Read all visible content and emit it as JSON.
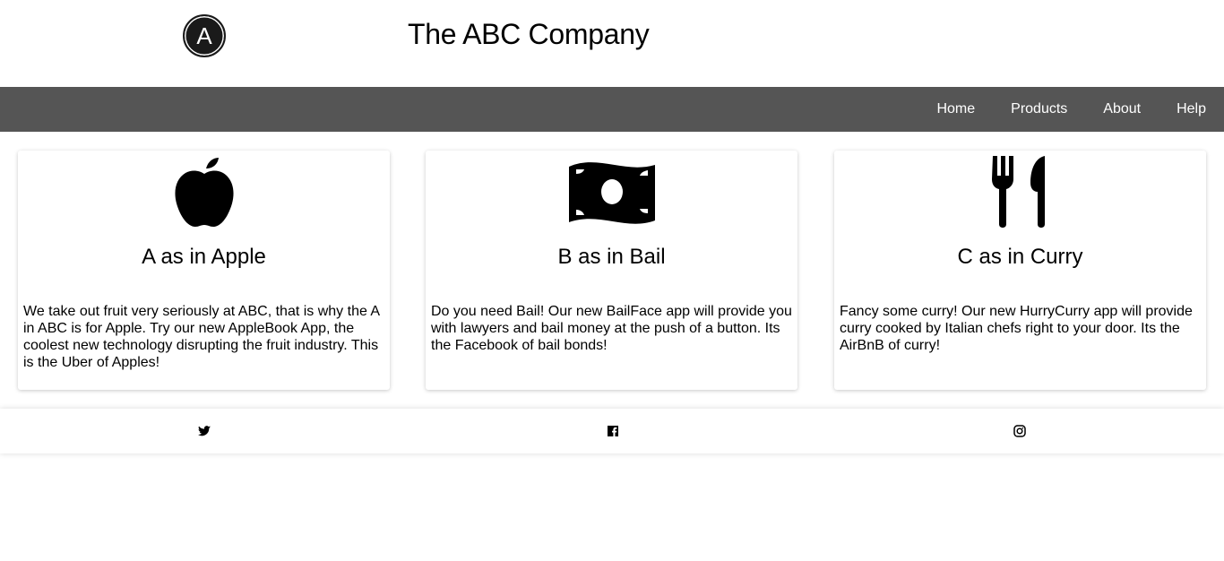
{
  "header": {
    "logo_letter": "A",
    "title": "The ABC Company"
  },
  "nav": {
    "items": [
      "Home",
      "Products",
      "About",
      "Help"
    ]
  },
  "cards": [
    {
      "icon": "apple-icon",
      "title": "A as in Apple",
      "text": "We take out fruit very seriously at ABC, that is why the A in ABC is for Apple. Try our new AppleBook App, the coolest new technology disrupting the fruit industry. This is the Uber of Apples!"
    },
    {
      "icon": "money-bill-icon",
      "title": "B as in Bail",
      "text": "Do you need Bail! Our new BailFace app will provide you with lawyers and bail money at the push of a button. Its the Facebook of bail bonds!"
    },
    {
      "icon": "utensils-icon",
      "title": "C as in Curry",
      "text": "Fancy some curry! Our new HurryCurry app will provide curry cooked by Italian chefs right to your door. Its the AirBnB of curry!"
    }
  ],
  "footer": {
    "icons": [
      "twitter-icon",
      "facebook-icon",
      "instagram-icon"
    ]
  }
}
